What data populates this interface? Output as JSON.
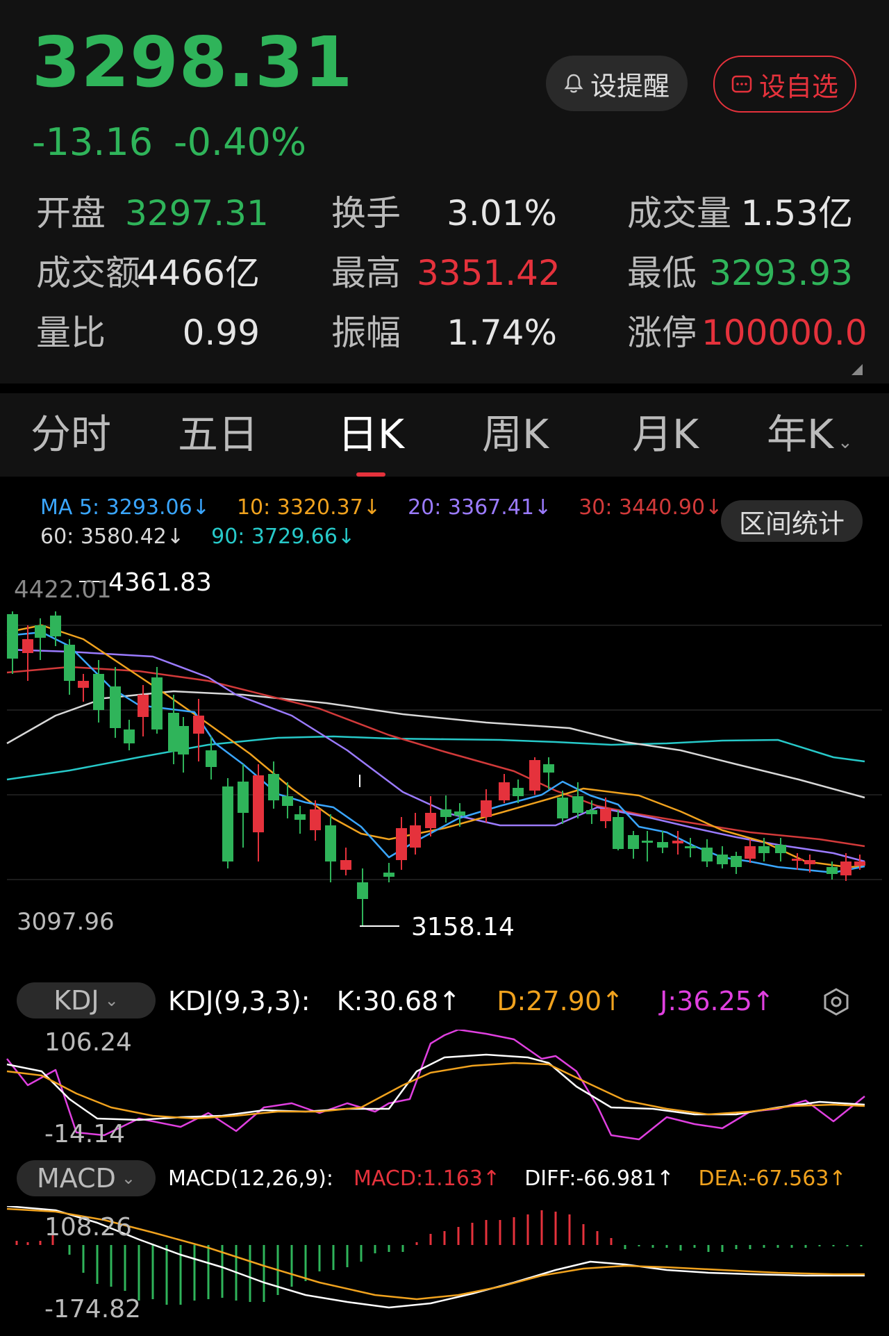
{
  "quote": {
    "price": "3298.31",
    "change": "-13.16",
    "change_pct": "-0.40%",
    "alert_label": "设提醒",
    "watch_label": "设自选",
    "stats": [
      {
        "label": "开盘",
        "value": "3297.31",
        "color": "green"
      },
      {
        "label": "换手",
        "value": "3.01%",
        "color": "white"
      },
      {
        "label": "成交量",
        "value": "1.53亿",
        "color": "white"
      },
      {
        "label": "成交额",
        "value": "4466亿",
        "color": "white"
      },
      {
        "label": "最高",
        "value": "3351.42",
        "color": "red"
      },
      {
        "label": "最低",
        "value": "3293.93",
        "color": "green"
      },
      {
        "label": "量比",
        "value": "0.99",
        "color": "white"
      },
      {
        "label": "振幅",
        "value": "1.74%",
        "color": "white"
      },
      {
        "label": "涨停",
        "value": "100000.0",
        "color": "red"
      }
    ]
  },
  "tabs": [
    "分时",
    "五日",
    "日K",
    "周K",
    "月K",
    "年K"
  ],
  "active_tab": "日K",
  "ma": {
    "ma5": "MA 5: 3293.06↓",
    "ma10": "10: 3320.37↓",
    "ma20": "20: 3367.41↓",
    "ma30": "30: 3440.90↓",
    "ma60": "60: 3580.42↓",
    "ma90": "90: 3729.66↓"
  },
  "range_stats_label": "区间统计",
  "kline": {
    "y_top_label": "4422.01",
    "y_bottom_label": "3097.96",
    "high_marker": "4361.83",
    "low_marker": "3158.14"
  },
  "kdj": {
    "selector": "KDJ",
    "params": "KDJ(9,3,3):",
    "k": "K:30.68↑",
    "d": "D:27.90↑",
    "j": "J:36.25↑",
    "y_top": "106.24",
    "y_bottom": "-14.14"
  },
  "macd": {
    "selector": "MACD",
    "params": "MACD(12,26,9):",
    "macd": "MACD:1.163↑",
    "diff": "DIFF:-66.981↑",
    "dea": "DEA:-67.563↑",
    "y_top": "108.26",
    "y_bottom": "-174.82"
  },
  "colors": {
    "up": "#e5323c",
    "down": "#2fb45a",
    "ma5": "#3aa6ff",
    "ma10": "#f0a21e",
    "ma20": "#9b7bff",
    "ma30": "#d23a3a",
    "ma60": "#d8d8d8",
    "ma90": "#27c9c9",
    "kdj_k": "#ffffff",
    "kdj_d": "#f0a21e",
    "kdj_j": "#e040e0"
  }
}
